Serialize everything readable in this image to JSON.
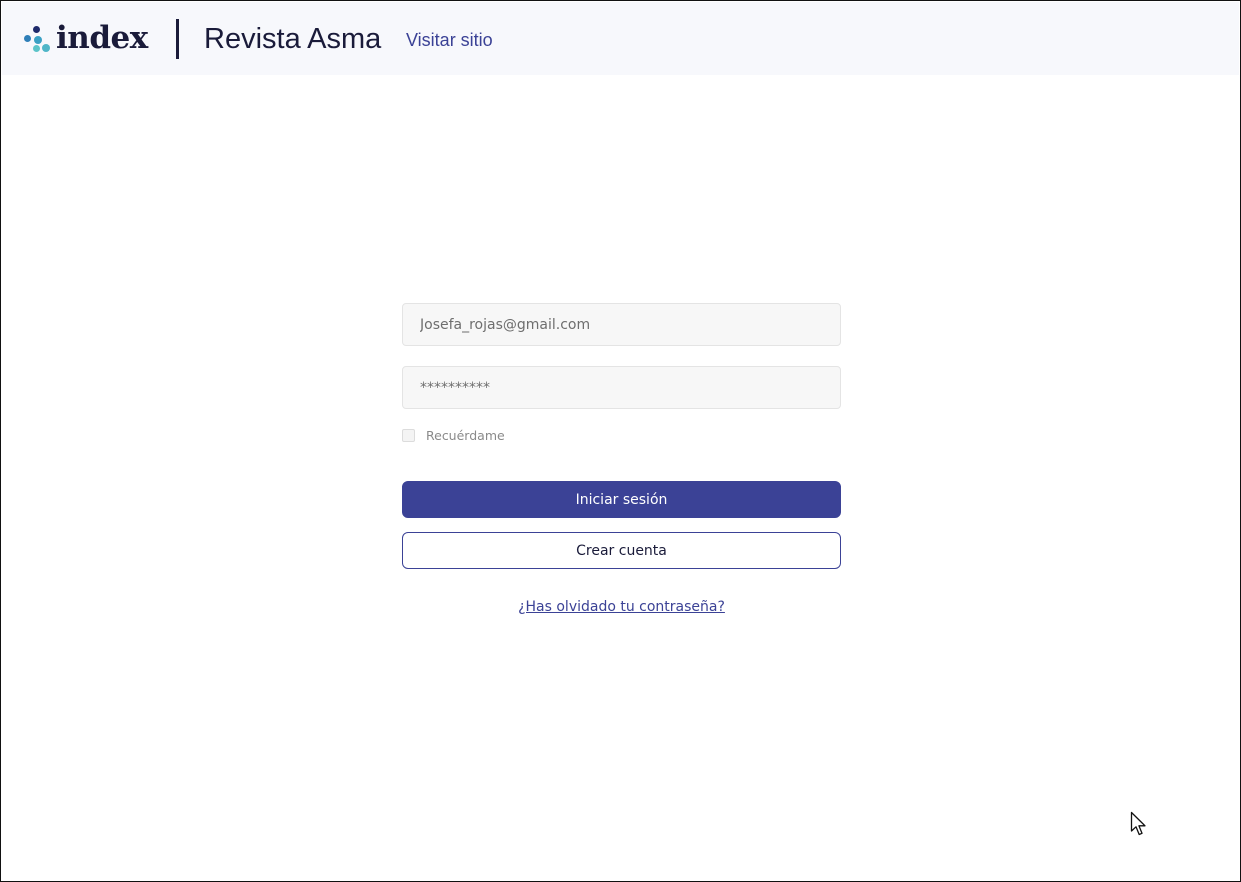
{
  "header": {
    "logo_text": "index",
    "journal_title": "Revista Asma",
    "visit_link": "Visitar sitio"
  },
  "login": {
    "email_value": "Josefa_rojas@gmail.com",
    "password_value": "**********",
    "remember_label": "Recuérdame",
    "remember_checked": false,
    "login_button": "Iniciar sesión",
    "create_account_button": "Crear cuenta",
    "forgot_password_link": "¿Has olvidado tu contraseña?"
  },
  "icons": {
    "logo_mark": "index-logo-dots-icon",
    "cursor": "mouse-pointer-icon"
  },
  "colors": {
    "primary": "#3b4296",
    "text_dark": "#1a1b3a",
    "header_bg": "#f7f8fc",
    "field_bg": "#f7f7f7",
    "logo_dots": [
      "#1e2a6b",
      "#2f7fb8",
      "#5cc4c9"
    ]
  }
}
